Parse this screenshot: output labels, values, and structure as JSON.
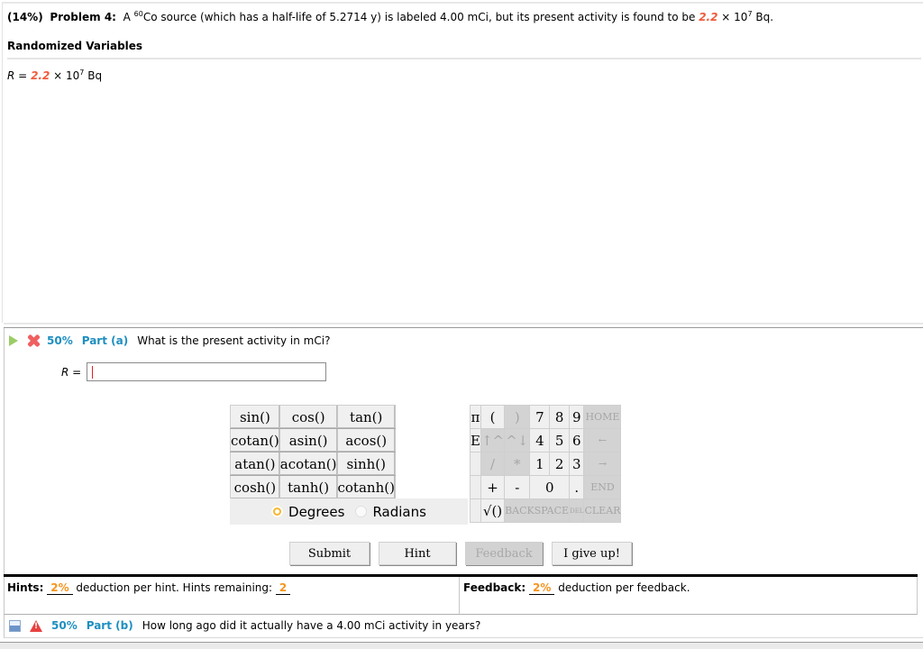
{
  "problem": {
    "weight": "(14%)",
    "label": "Problem 4:",
    "text_a": "A",
    "isotope_mass": "60",
    "text_b": "Co source (which has a half-life of 5.2714 y) is labeled 4.00 mCi, but its present activity is found to be",
    "value": "2.2",
    "times": "× 10",
    "exponent": "7",
    "unit": "Bq."
  },
  "randomized": {
    "title": "Randomized Variables",
    "var_name": "R",
    "equals": "=",
    "value": "2.2",
    "times": "× 10",
    "exponent": "7",
    "unit": "Bq"
  },
  "part_a": {
    "weight": "50%",
    "label": "Part (a)",
    "question": "What is the present activity in mCi?",
    "answer_label": "R =",
    "answer_value": ""
  },
  "calculator": {
    "functions": [
      [
        "sin()",
        "cos()",
        "tan()"
      ],
      [
        "cotan()",
        "asin()",
        "acos()"
      ],
      [
        "atan()",
        "acotan()",
        "sinh()"
      ],
      [
        "cosh()",
        "tanh()",
        "cotanh()"
      ]
    ],
    "angle_modes": {
      "degrees": "Degrees",
      "radians": "Radians",
      "selected": "Degrees"
    },
    "keys": {
      "pi": "π",
      "e": "E",
      "lparen": "(",
      "rparen": ")",
      "up": "↑^",
      "down": "^↓",
      "divide": "/",
      "multiply": "*",
      "plus": "+",
      "minus": "-",
      "sqrt": "√()",
      "dot": ".",
      "d7": "7",
      "d8": "8",
      "d9": "9",
      "d4": "4",
      "d5": "5",
      "d6": "6",
      "d1": "1",
      "d2": "2",
      "d3": "3",
      "d0": "0",
      "home": "HOME",
      "left": "←",
      "right": "→",
      "end": "END",
      "backspace": "BACKSPACE",
      "del": "DEL",
      "clear": "CLEAR"
    }
  },
  "actions": {
    "submit": "Submit",
    "hint": "Hint",
    "feedback": "Feedback",
    "give_up": "I give up!"
  },
  "hints": {
    "label": "Hints:",
    "deduction": "2%",
    "text": "deduction per hint. Hints remaining:",
    "remaining": "2"
  },
  "feedback": {
    "label": "Feedback:",
    "deduction": "2%",
    "text": "deduction per feedback."
  },
  "part_b": {
    "weight": "50%",
    "label": "Part (b)",
    "question": "How long ago did it actually have a 4.00 mCi activity in years?"
  },
  "colors": {
    "accent_blue": "#1e8fc0",
    "random_value_red": "#f05a3c",
    "deduction_orange": "#f7941d"
  }
}
